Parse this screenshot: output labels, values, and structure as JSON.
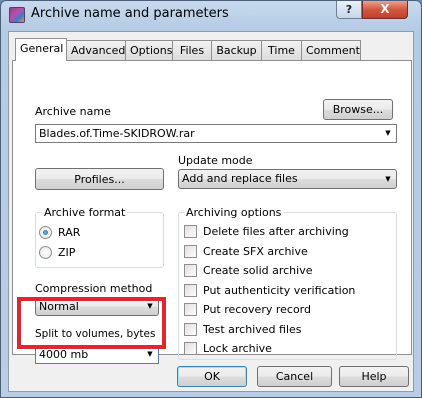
{
  "window": {
    "title": "Archive name and parameters",
    "help_btn": "?",
    "close_btn": "X"
  },
  "tabs": [
    "General",
    "Advanced",
    "Options",
    "Files",
    "Backup",
    "Time",
    "Comment"
  ],
  "archive_name": {
    "label": "Archive name",
    "value": "Blades.of.Time-SKIDROW.rar",
    "browse": "Browse..."
  },
  "profiles_btn": "Profiles...",
  "update_mode": {
    "label": "Update mode",
    "value": "Add and replace files"
  },
  "archive_format": {
    "title": "Archive format",
    "options": [
      "RAR",
      "ZIP"
    ],
    "selected": "RAR"
  },
  "compression": {
    "label": "Compression method",
    "value": "Normal"
  },
  "split": {
    "label": "Split to volumes, bytes",
    "value": "4000 mb"
  },
  "archiving_options": {
    "title": "Archiving options",
    "items": [
      "Delete files after archiving",
      "Create SFX archive",
      "Create solid archive",
      "Put authenticity verification",
      "Put recovery record",
      "Test archived files",
      "Lock archive"
    ]
  },
  "buttons": {
    "ok": "OK",
    "cancel": "Cancel",
    "help": "Help"
  }
}
